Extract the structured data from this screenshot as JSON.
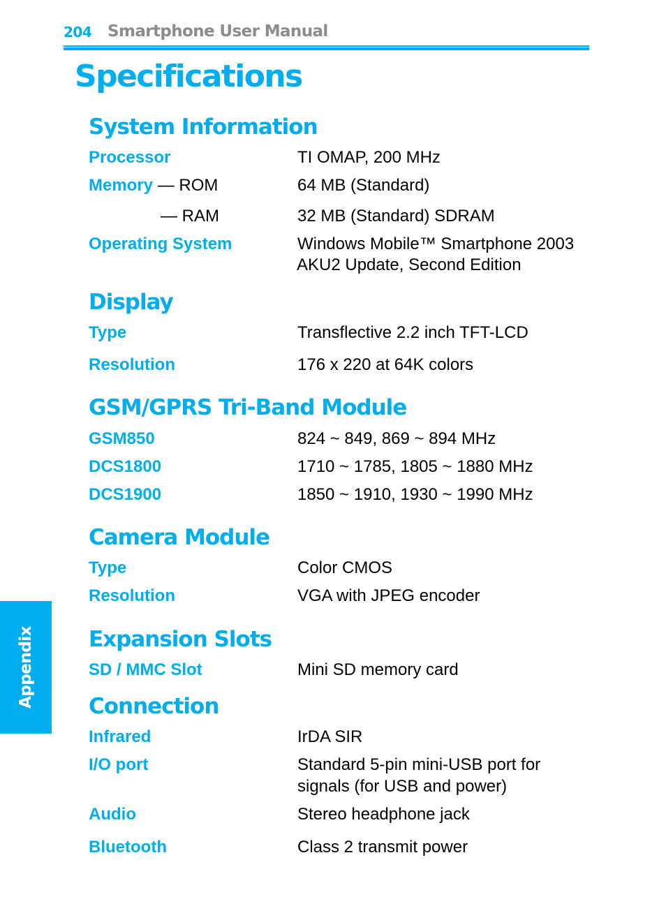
{
  "header": {
    "page_number": "204",
    "manual_title": "Smartphone User Manual"
  },
  "page_title": "Specifications",
  "side_tab": {
    "label": "Appendix"
  },
  "colors": {
    "accent": "#00aeef",
    "header_gray": "#8c8c8c",
    "text": "#000000"
  },
  "sections": {
    "system": {
      "title": "System Information",
      "processor": {
        "label": "Processor",
        "value": "TI OMAP, 200 MHz"
      },
      "memory_rom": {
        "label": "Memory",
        "sublabel": " — ROM",
        "value": "64 MB (Standard)"
      },
      "memory_ram": {
        "sublabel": "— RAM",
        "value": "32 MB (Standard) SDRAM"
      },
      "os": {
        "label": "Operating System",
        "value_line1": "Windows Mobile™ Smartphone 2003",
        "value_line2": "AKU2 Update, Second Edition"
      }
    },
    "display": {
      "title": "Display",
      "type": {
        "label": "Type",
        "value": "Transflective 2.2 inch TFT-LCD"
      },
      "resolution": {
        "label": "Resolution",
        "value": "176 x 220 at  64K colors"
      }
    },
    "gsm": {
      "title": "GSM/GPRS Tri-Band Module",
      "gsm850": {
        "label": "GSM850",
        "value": "824 ~ 849, 869 ~ 894 MHz"
      },
      "dcs1800": {
        "label": "DCS1800",
        "value": "1710 ~ 1785, 1805 ~ 1880 MHz"
      },
      "dcs1900": {
        "label": "DCS1900",
        "value": "1850 ~ 1910, 1930 ~ 1990 MHz"
      }
    },
    "camera": {
      "title": "Camera Module",
      "type": {
        "label": "Type",
        "value": "Color CMOS"
      },
      "resolution": {
        "label": "Resolution",
        "value": "VGA with JPEG encoder"
      }
    },
    "expansion": {
      "title": "Expansion Slots",
      "sd": {
        "label": "SD / MMC Slot",
        "value": "Mini SD memory card"
      }
    },
    "connection": {
      "title": "Connection",
      "infrared": {
        "label": "Infrared",
        "value": "IrDA SIR"
      },
      "io": {
        "label": "I/O port",
        "value_line1": "Standard 5-pin mini-USB port for",
        "value_line2": "signals (for USB and power)"
      },
      "audio": {
        "label": "Audio",
        "value": "Stereo headphone jack"
      },
      "bluetooth": {
        "label": "Bluetooth",
        "value": "Class 2 transmit power"
      }
    }
  }
}
